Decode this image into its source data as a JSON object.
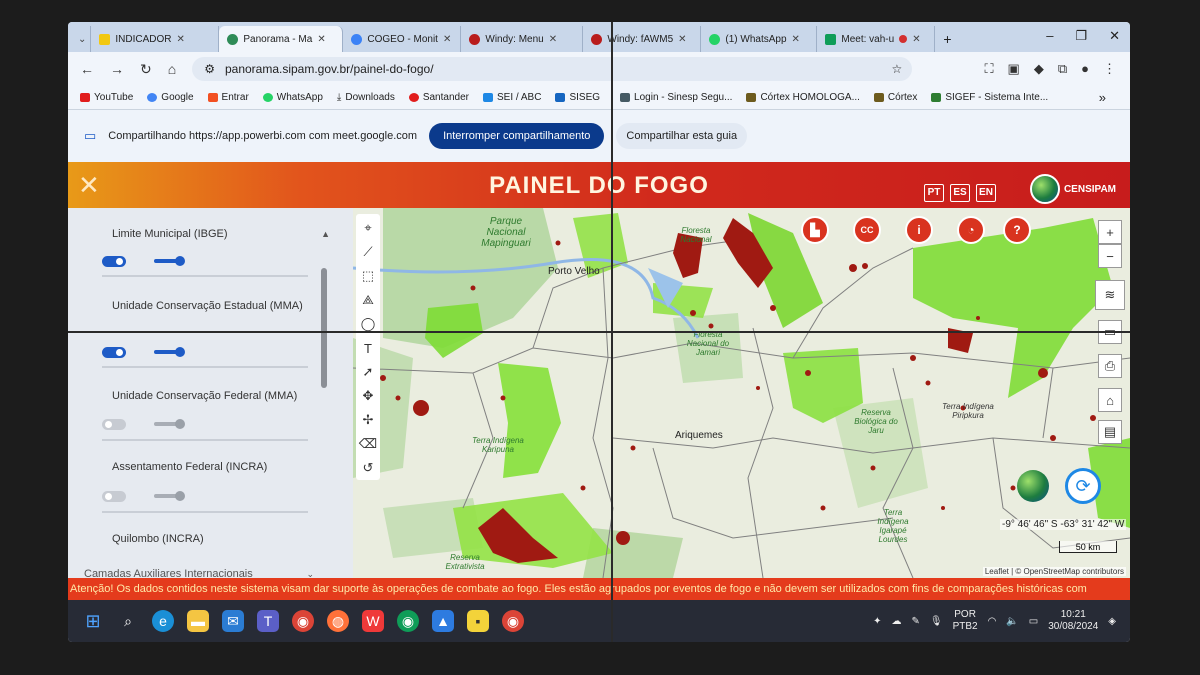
{
  "browser": {
    "tabs": [
      {
        "label": "INDICADOR",
        "icon": "powerbi-icon",
        "color": "#f2c811"
      },
      {
        "label": "Panorama - Ma",
        "icon": "globe-icon",
        "color": "#2e8b57",
        "active": true
      },
      {
        "label": "COGEO - Monit",
        "icon": "globe-icon",
        "color": "#3b82f6"
      },
      {
        "label": "Windy: Menu",
        "icon": "windy-icon",
        "color": "#b91c1c"
      },
      {
        "label": "Windy: fAWM5",
        "icon": "windy-icon",
        "color": "#b91c1c"
      },
      {
        "label": "(1) WhatsApp",
        "icon": "whatsapp-icon",
        "color": "#25d366"
      },
      {
        "label": "Meet: vah-u",
        "icon": "meet-icon",
        "color": "#0f9d58"
      }
    ],
    "url": "panorama.sipam.gov.br/painel-do-fogo/",
    "bookmarks": [
      {
        "label": "YouTube",
        "color": "#e11d1d"
      },
      {
        "label": "Google",
        "color": "#4285f4"
      },
      {
        "label": "Entrar",
        "color": "#f25022"
      },
      {
        "label": "WhatsApp",
        "color": "#25d366"
      },
      {
        "label": "Downloads",
        "color": "#333333"
      },
      {
        "label": "Santander",
        "color": "#e11d1d"
      },
      {
        "label": "SEI / ABC",
        "color": "#1e88e5"
      },
      {
        "label": "SISEG",
        "color": "#1565c0"
      },
      {
        "label": "Login - Sinesp Segu...",
        "color": "#455a64"
      },
      {
        "label": "Córtex HOMOLOGA...",
        "color": "#6d5b1e"
      },
      {
        "label": "Córtex",
        "color": "#6d5b1e"
      },
      {
        "label": "SIGEF - Sistema Inte...",
        "color": "#2e7d32"
      }
    ],
    "more_bookmarks": "»"
  },
  "sharebar": {
    "text": "Compartilhando https://app.powerbi.com com meet.google.com",
    "stop_label": "Interromper compartilhamento",
    "share_tab_label": "Compartilhar esta guia"
  },
  "app": {
    "title": "PAINEL DO FOGO",
    "close": "✕",
    "langs": [
      "PT",
      "ES",
      "EN"
    ],
    "logo_text": "CENSIPAM",
    "ticker": "Atenção! Os dados contidos neste sistema visam dar suporte às operações de combate ao fogo. Eles estão agrupados por eventos de fogo e não devem ser utilizados com fins de comparações históricas com"
  },
  "sidebar": {
    "layers": [
      {
        "label": "Limite Municipal (IBGE)",
        "on": true
      },
      {
        "label": "Unidade Conservação Estadual (MMA)",
        "on": true
      },
      {
        "label": "Unidade Conservação Federal (MMA)",
        "on": false
      },
      {
        "label": "Assentamento Federal (INCRA)",
        "on": false
      },
      {
        "label": "Quilombo (INCRA)",
        "on": false
      }
    ],
    "aux_section": "Camadas Auxiliares Internacionais"
  },
  "map": {
    "tools": [
      "pin-icon",
      "polyline-icon",
      "square-icon",
      "polygon-icon",
      "circle-icon",
      "text-icon",
      "cursor-icon",
      "move-icon",
      "rotate-icon",
      "eraser-icon",
      "undo-icon"
    ],
    "top_buttons": [
      {
        "name": "chart-button",
        "glyph": "▙"
      },
      {
        "name": "cc-button",
        "glyph": "CC"
      },
      {
        "name": "info-button",
        "glyph": "i"
      },
      {
        "name": "pie-button",
        "glyph": "◔"
      },
      {
        "name": "help-button",
        "glyph": "?"
      }
    ],
    "zoom_in": "+",
    "zoom_out": "−",
    "labels": {
      "porto_velho": "Porto Velho",
      "ariquemes": "Ariquemes",
      "parque": "Parque Nacional Mapinguari",
      "floresta_jamari": "Floresta Nacional do Jamari",
      "floresta_n": "Floresta Nacional",
      "tri_karipuna": "Terra Indígena Karipuna",
      "tri_piripkura": "Terra Indígena Piripkura",
      "rebio_jaru": "Reserva Biológica do Jaru",
      "tri_igarape": "Terra Indígena Igarapé Lourdes",
      "reserva_extrativista": "Reserva Extrativista"
    },
    "coords": "-9° 46' 46\" S -63° 31' 42\" W",
    "scale": "50 km",
    "attribution": "Leaflet | © OpenStreetMap contributors"
  },
  "taskbar": {
    "lang": "POR",
    "layout": "PTB2",
    "time": "10:21",
    "date": "30/08/2024"
  }
}
